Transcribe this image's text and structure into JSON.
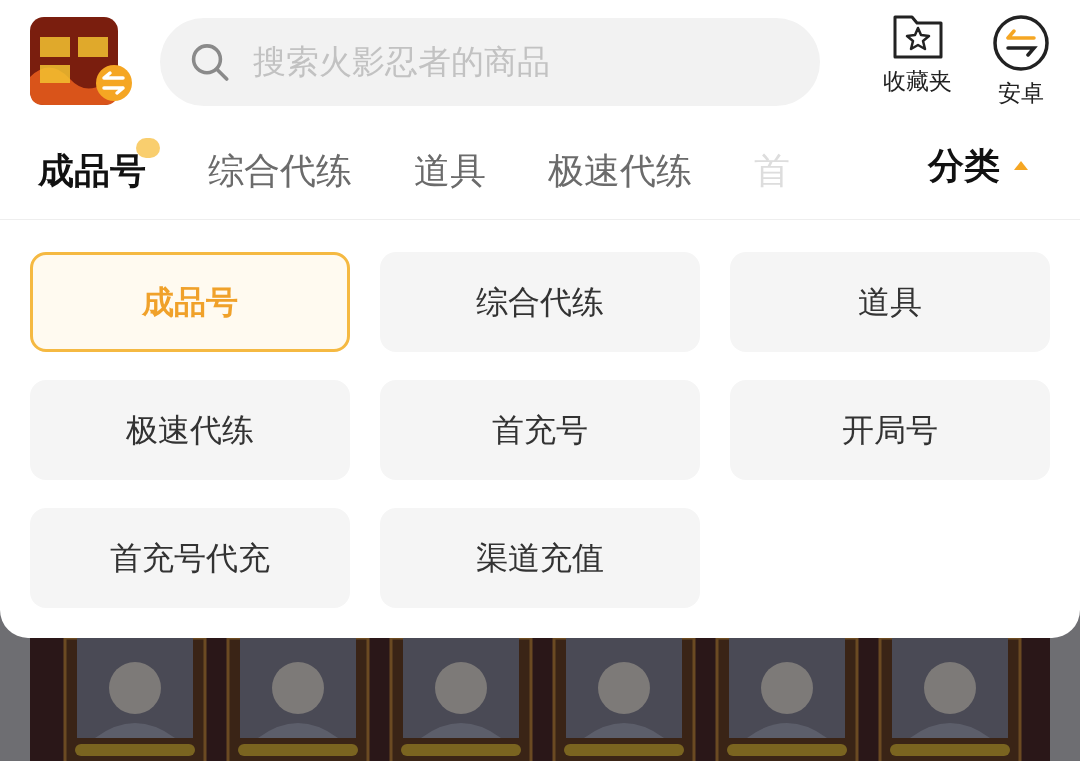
{
  "search": {
    "placeholder": "搜索火影忍者的商品"
  },
  "header_actions": [
    {
      "kind": "favorites",
      "label": "收藏夹"
    },
    {
      "kind": "switch",
      "label": "安卓"
    }
  ],
  "tabs": [
    {
      "label": "成品号",
      "selected": true,
      "faded": false
    },
    {
      "label": "综合代练",
      "selected": false,
      "faded": false
    },
    {
      "label": "道具",
      "selected": false,
      "faded": false
    },
    {
      "label": "极速代练",
      "selected": false,
      "faded": false
    },
    {
      "label": "首",
      "selected": false,
      "faded": true
    }
  ],
  "category_toggle": {
    "label": "分类",
    "expanded": true
  },
  "categories": [
    {
      "label": "成品号",
      "selected": true
    },
    {
      "label": "综合代练",
      "selected": false
    },
    {
      "label": "道具",
      "selected": false
    },
    {
      "label": "极速代练",
      "selected": false
    },
    {
      "label": "首充号",
      "selected": false
    },
    {
      "label": "开局号",
      "selected": false
    },
    {
      "label": "首充号代充",
      "selected": false
    },
    {
      "label": "渠道充值",
      "selected": false
    }
  ]
}
